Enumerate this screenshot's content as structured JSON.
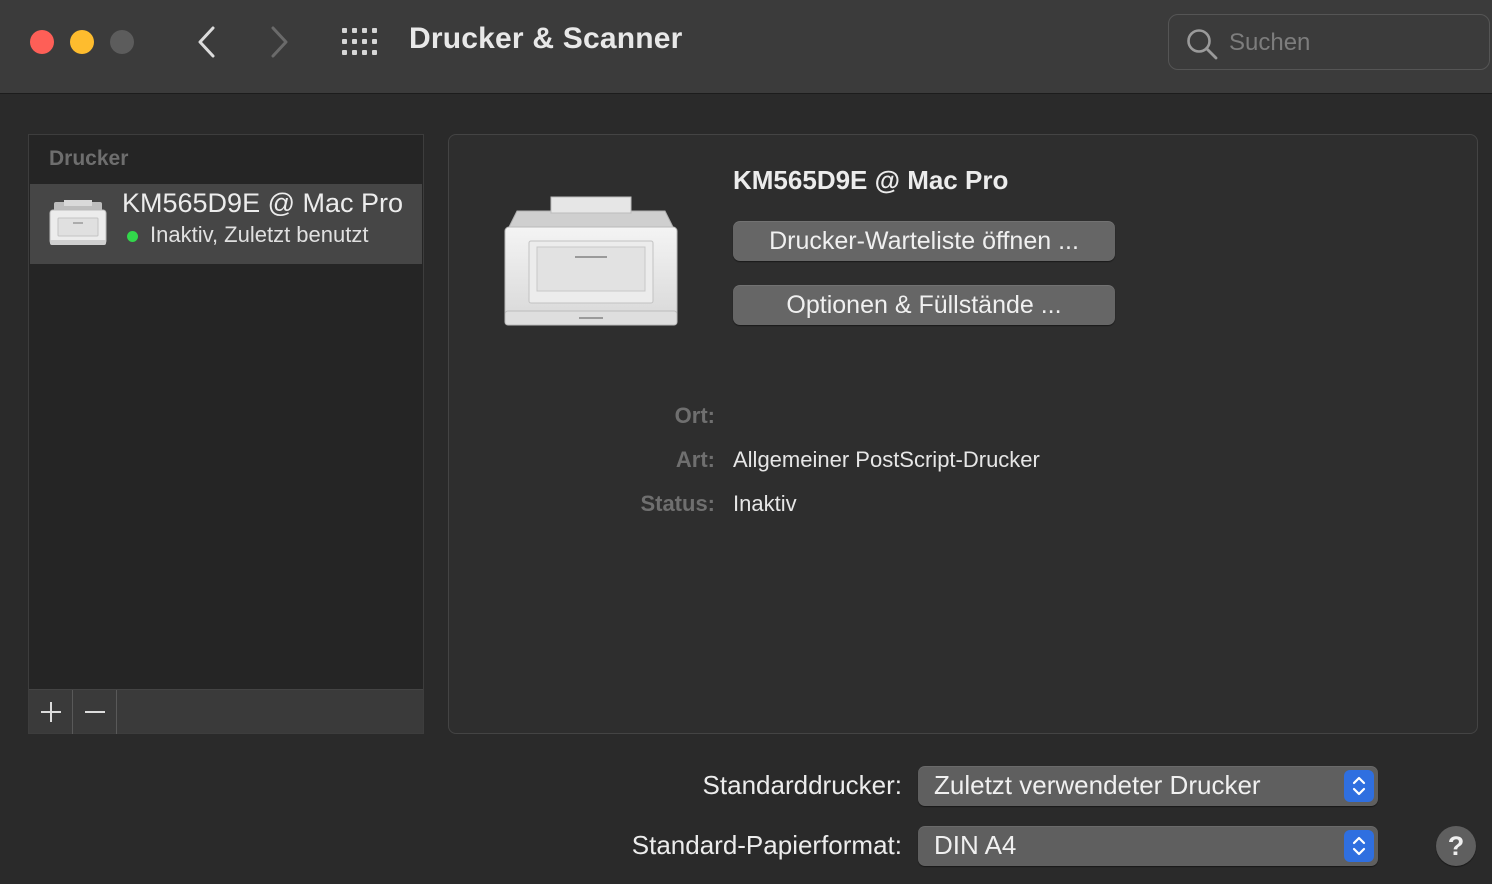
{
  "window": {
    "title": "Drucker & Scanner",
    "search_placeholder": "Suchen"
  },
  "printer_list": {
    "header": "Drucker",
    "items": [
      {
        "name": "KM565D9E @ Mac Pro",
        "status": "Inaktiv, Zuletzt benutzt",
        "status_color": "#32d74b"
      }
    ],
    "add_label": "+",
    "remove_label": "—"
  },
  "details": {
    "printer_name": "KM565D9E @ Mac Pro",
    "open_queue_button": "Drucker-Warteliste öffnen ...",
    "options_button": "Optionen & Füllstände ...",
    "location_label": "Ort:",
    "location_value": "",
    "kind_label": "Art:",
    "kind_value": "Allgemeiner PostScript-Drucker",
    "status_label": "Status:",
    "status_value": "Inaktiv"
  },
  "settings": {
    "default_printer_label": "Standarddrucker:",
    "default_printer_value": "Zuletzt verwendeter Drucker",
    "paper_size_label": "Standard-Papierformat:",
    "paper_size_value": "DIN A4",
    "help_label": "?"
  },
  "colors": {
    "accent": "#2f6fe0",
    "close": "#fe5f57",
    "minimize": "#febc2e",
    "status_active": "#32d74b"
  }
}
